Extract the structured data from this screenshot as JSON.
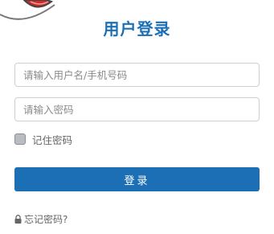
{
  "title": "用户登录",
  "username": {
    "placeholder": "请输入用户名/手机号码",
    "value": ""
  },
  "password": {
    "placeholder": "请输入密码",
    "value": ""
  },
  "remember": {
    "label": "记住密码",
    "checked": false
  },
  "login_button": {
    "label": "登录"
  },
  "forgot_link": {
    "label": "忘记密码?",
    "icon": "lock-icon"
  },
  "colors": {
    "accent": "#1c6fb5",
    "logo_red": "#d42a2a",
    "logo_outline": "#444444"
  }
}
